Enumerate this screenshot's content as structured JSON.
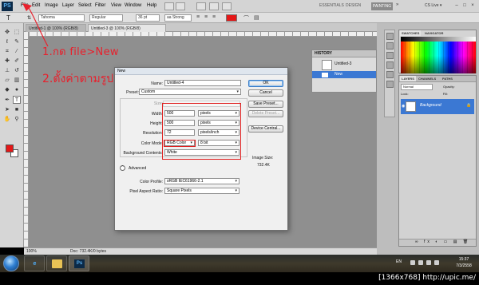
{
  "menubar": {
    "logo": "PS",
    "items": [
      "File",
      "Edit",
      "Image",
      "Layer",
      "Select",
      "Filter",
      "View",
      "Window",
      "Help"
    ],
    "workspaces": [
      "ESSENTIALS",
      "DESIGN",
      "PAINTING"
    ],
    "more": "»",
    "cs_live": "CS Live ▾"
  },
  "optbar": {
    "font_family": "Tahoma",
    "font_style": "Regular",
    "font_size": "36 pt",
    "antialias": "aa  Strong",
    "text_color": "#e51717"
  },
  "tabs": [
    "Untitled-1 @ 100% (RGB/8)",
    "Untitled-3 @ 100% (RGB/8)"
  ],
  "toolbar": {
    "tool_icons": [
      "move",
      "marquee",
      "lasso",
      "quick-select",
      "crop",
      "eyedropper",
      "heal",
      "brush",
      "stamp",
      "history-brush",
      "eraser",
      "gradient",
      "blur",
      "dodge",
      "pen",
      "type",
      "path-select",
      "shape",
      "hand",
      "zoom"
    ],
    "foreground_color": "#e51717",
    "background_color": "#ffffff"
  },
  "status": {
    "zoom": "100%",
    "doc": "Doc: 732.4K/0 bytes"
  },
  "history": {
    "tab": "HISTORY",
    "snapshot": "Untitled-3",
    "step": "New"
  },
  "swatches": {
    "tabs": [
      "SWATCHES",
      "NAVIGATOR"
    ]
  },
  "layers": {
    "tabs": [
      "LAYERS",
      "CHANNELS",
      "PATHS"
    ],
    "mode": "Normal",
    "opacity_label": "Opacity:",
    "lock_label": "Lock:",
    "fill_label": "Fill:",
    "layer_name": "Background",
    "footer_icons": "∞ fx ◐ ▭ ▤ 🗑"
  },
  "dialog": {
    "title": "New",
    "name_label": "Name:",
    "name_value": "Untitled-4",
    "preset_label": "Preset:",
    "preset_value": "Custom",
    "size_label": "Size:",
    "width_label": "Width:",
    "width_value": "500",
    "width_unit": "pixels",
    "height_label": "Height:",
    "height_value": "500",
    "height_unit": "pixels",
    "resolution_label": "Resolution:",
    "resolution_value": "72",
    "resolution_unit": "pixels/inch",
    "color_mode_label": "Color Mode:",
    "color_mode_value": "RGB Color",
    "color_mode_depth": "8 bit",
    "bg_contents_label": "Background Contents:",
    "bg_contents_value": "White",
    "advanced_label": "Advanced",
    "color_profile_label": "Color Profile:",
    "color_profile_value": "sRGB IEC61966-2.1",
    "pixel_aspect_label": "Pixel Aspect Ratio:",
    "pixel_aspect_value": "Square Pixels",
    "buttons": {
      "ok": "OK",
      "cancel": "Cancel",
      "save_preset": "Save Preset...",
      "delete_preset": "Delete Preset...",
      "device_central": "Device Central..."
    },
    "image_size_label": "Image Size:",
    "image_size_value": "732.4K"
  },
  "annotations": {
    "step1": "1.กด file>New",
    "step2": "2.ตั้งค่าตามรูป",
    "accent_color": "#e8202c"
  },
  "taskbar": {
    "lang": "EN",
    "time": "15:37",
    "date": "7/3/2558",
    "apps": [
      "ie",
      "explorer",
      "photoshop"
    ]
  },
  "watermark": "[1366x768] http://upic.me/"
}
